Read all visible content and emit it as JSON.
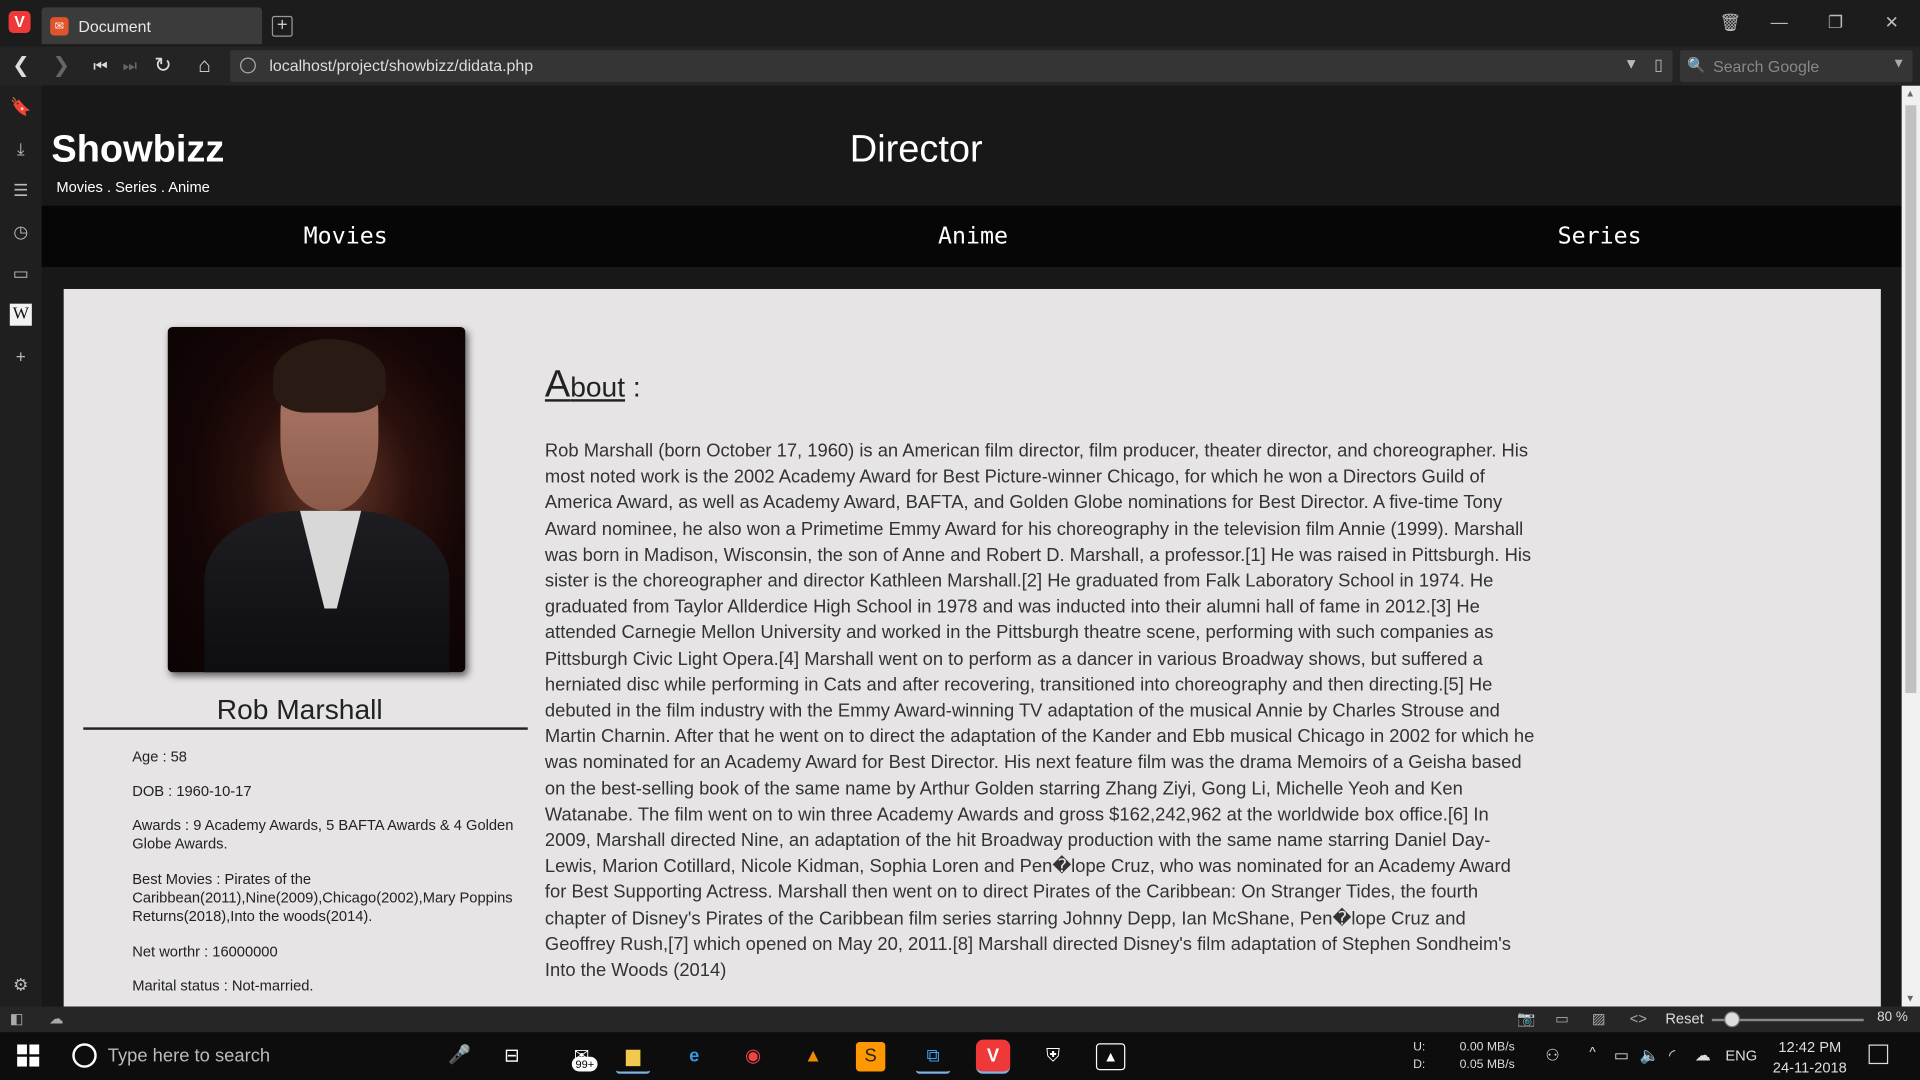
{
  "browser": {
    "tab_title": "Document",
    "url": "localhost/project/showbizz/didata.php",
    "search_placeholder": "Search Google",
    "zoom_reset_label": "Reset",
    "zoom_level": "80 %"
  },
  "site": {
    "brand": "Showbizz",
    "tagline": "Movies . Series . Anime",
    "page_title": "Director",
    "nav": [
      "Movies",
      "Anime",
      "Series"
    ]
  },
  "profile": {
    "name": "Rob Marshall",
    "age": "Age  :  58",
    "dob": "DOB  :  1960-10-17",
    "awards": "Awards  :  9 Academy Awards, 5 BAFTA Awards & 4 Golden Globe Awards.",
    "best_movies": "Best Movies  :  Pirates of the Caribbean(2011),Nine(2009),Chicago(2002),Mary Poppins Returns(2018),Into the woods(2014).",
    "net_worth": "Net worthr  :  16000000",
    "marital_status": "Marital status  :  Not-married."
  },
  "about": {
    "heading_first": "A",
    "heading_rest": "bout",
    "heading_suffix": " :",
    "text": "Rob Marshall (born October 17, 1960) is an American film director, film producer, theater director, and choreographer. His most noted work is the 2002 Academy Award for Best Picture-winner Chicago, for which he won a Directors Guild of America Award, as well as Academy Award, BAFTA, and Golden Globe nominations for Best Director. A five-time Tony Award nominee, he also won a Primetime Emmy Award for his choreography in the television film Annie (1999). Marshall was born in Madison, Wisconsin, the son of Anne and Robert D. Marshall, a professor.[1] He was raised in Pittsburgh. His sister is the choreographer and director Kathleen Marshall.[2] He graduated from Falk Laboratory School in 1974. He graduated from Taylor Allderdice High School in 1978 and was inducted into their alumni hall of fame in 2012.[3] He attended Carnegie Mellon University and worked in the Pittsburgh theatre scene, performing with such companies as Pittsburgh Civic Light Opera.[4] Marshall went on to perform as a dancer in various Broadway shows, but suffered a herniated disc while performing in Cats and after recovering, transitioned into choreography and then directing.[5] He debuted in the film industry with the Emmy Award-winning TV adaptation of the musical Annie by Charles Strouse and Martin Charnin. After that he went on to direct the adaptation of the Kander and Ebb musical Chicago in 2002 for which he was nominated for an Academy Award for Best Director. His next feature film was the drama Memoirs of a Geisha based on the best-selling book of the same name by Arthur Golden starring Zhang Ziyi, Gong Li, Michelle Yeoh and Ken Watanabe. The film went on to win three Academy Awards and gross $162,242,962 at the worldwide box office.[6] In 2009, Marshall directed Nine, an adaptation of the hit Broadway production with the same name starring Daniel Day-Lewis, Marion Cotillard, Nicole Kidman, Sophia Loren and Pen�lope Cruz, who was nominated for an Academy Award for Best Supporting Actress. Marshall then went on to direct Pirates of the Caribbean: On Stranger Tides, the fourth chapter of Disney's Pirates of the Caribbean film series starring Johnny Depp, Ian McShane, Pen�lope Cruz and Geoffrey Rush,[7] which opened on May 20, 2011.[8] Marshall directed Disney's film adaptation of Stephen Sondheim's Into the Woods (2014)"
  },
  "taskbar": {
    "search_placeholder": "Type here to search",
    "mail_badge": "99+",
    "net_labels": [
      "U:",
      "D:"
    ],
    "net_values": [
      "0.00 MB/s",
      "0.05 MB/s"
    ],
    "language": "ENG",
    "time": "12:42 PM",
    "date": "24-11-2018"
  },
  "icons": {
    "browser_logo": "V",
    "wiki": "W",
    "tab_favicon": "php-icon"
  },
  "colors": {
    "header_bg": "#181818",
    "nav_bg": "#060606",
    "content_bg": "#e6e4e4",
    "brand_red": "#ef3939"
  }
}
